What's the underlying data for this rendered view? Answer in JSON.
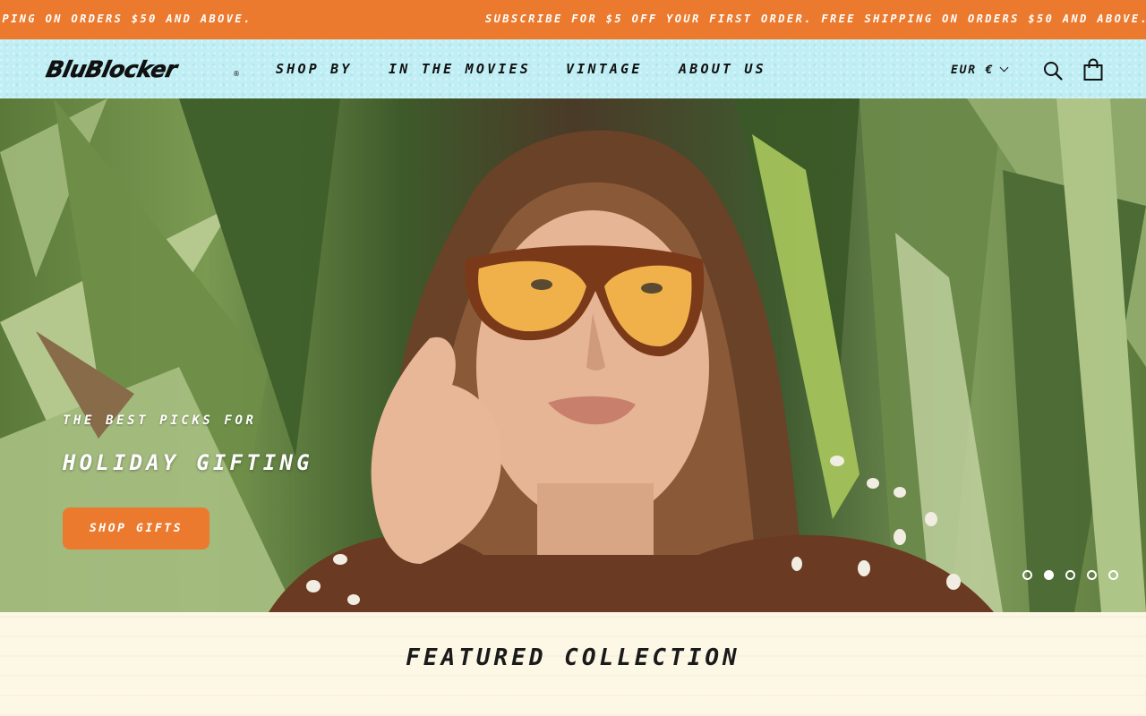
{
  "announcement": {
    "messages": [
      "SUBSCRIBE FOR $5 OFF YOUR FIRST ORDER. FREE SHIPPING ON ORDERS $50 AND ABOVE.",
      "SUBSCRIBE FOR $5 OFF YOUR FIRST ORDER. FREE SHIPPING ON ORDERS $50 AND ABOVE."
    ],
    "background": "#ec7a2e"
  },
  "header": {
    "logo_text": "BluBlocker",
    "logo_mark": "®",
    "nav": [
      "SHOP BY",
      "IN THE MOVIES",
      "VINTAGE",
      "ABOUT US"
    ],
    "currency": "EUR €",
    "icons": [
      "search-icon",
      "shopping-bag-icon",
      "chevron-down-icon"
    ],
    "background": "#bfeef4"
  },
  "hero": {
    "subtitle": "THE BEST PICKS FOR",
    "title": "HOLIDAY GIFTING",
    "button_label": "SHOP GIFTS",
    "slide_count": 5,
    "active_slide": 2,
    "accent": "#ec7a2e"
  },
  "featured": {
    "title": "FEATURED COLLECTION"
  }
}
